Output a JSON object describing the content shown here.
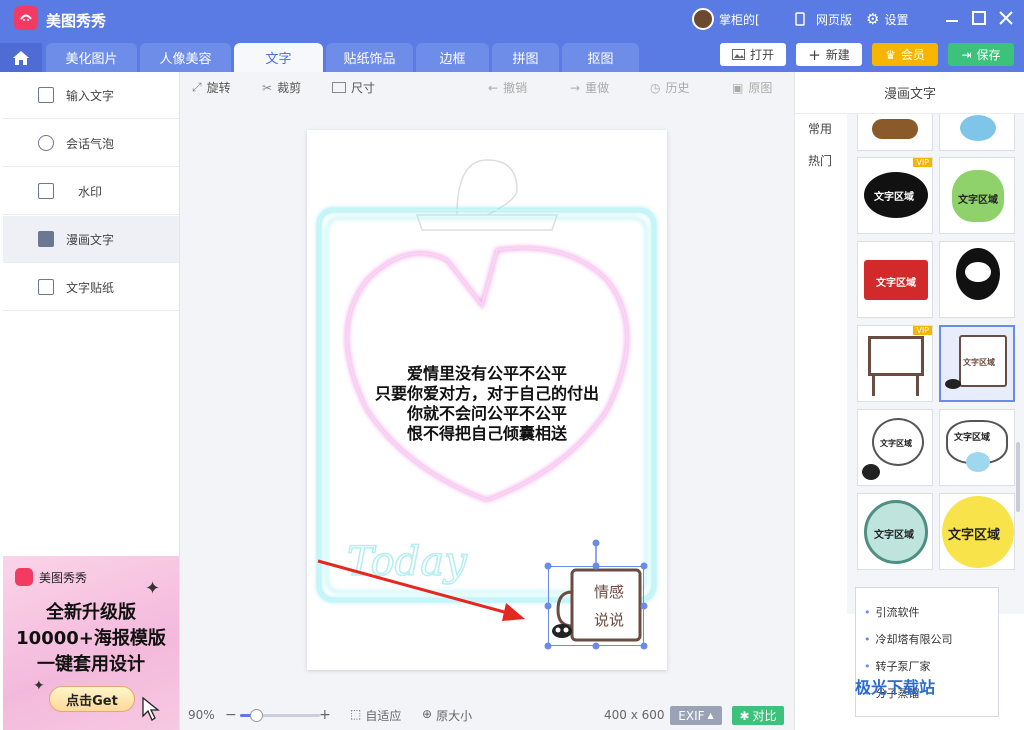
{
  "app": {
    "name": "美图秀秀"
  },
  "titlebar": {
    "user": "掌柜的[",
    "web_version": "网页版",
    "settings": "设置"
  },
  "tabs": [
    "美化图片",
    "人像美容",
    "文字",
    "贴纸饰品",
    "边框",
    "拼图",
    "抠图"
  ],
  "active_tab": "文字",
  "top_buttons": {
    "open": "打开",
    "new": "新建",
    "member": "会员",
    "save": "保存"
  },
  "sidebar": {
    "items": [
      {
        "label": "输入文字",
        "icon": "text-box-icon"
      },
      {
        "label": "会话气泡",
        "icon": "chat-bubble-icon"
      },
      {
        "label": "水印",
        "icon": "watermark-icon"
      },
      {
        "label": "漫画文字",
        "icon": "comic-text-icon"
      },
      {
        "label": "文字贴纸",
        "icon": "text-sticker-icon"
      }
    ],
    "active": "漫画文字"
  },
  "ad": {
    "brand": "美图秀秀",
    "line1": "全新升级版",
    "line2": "10000+海报模版",
    "line3": "一键套用设计",
    "button": "点击Get"
  },
  "toolbar": {
    "rotate": "旋转",
    "crop": "裁剪",
    "size": "尺寸",
    "undo": "撤销",
    "redo": "重做",
    "history": "历史",
    "original": "原图"
  },
  "photo": {
    "lines": [
      "爱情里没有公平不公平",
      "只要你爱对方，对于自己的付出",
      "你就不会问公平不公平",
      "恨不得把自己倾囊相送"
    ],
    "bubble_line1": "情感",
    "bubble_line2": "说说"
  },
  "status": {
    "zoom": "90%",
    "zoom_level": 0.2,
    "fit": "自适应",
    "actual": "原大小",
    "dimensions": "400 x 600",
    "exif": "EXIF",
    "compare": "对比"
  },
  "right_panel": {
    "title": "漫画文字",
    "categories": [
      "常用",
      "热门"
    ],
    "active_category": "热门",
    "thumb_text": "文字区域",
    "vip": "VIP",
    "links": [
      "引流软件",
      "冷却塔有限公司",
      "转子泵厂家",
      "分子蒸馏"
    ]
  },
  "watermark": "极光下载站"
}
